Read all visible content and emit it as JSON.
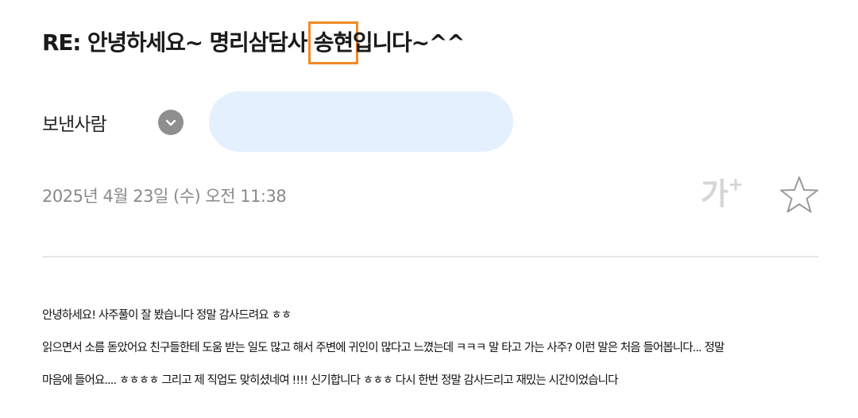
{
  "mail": {
    "subject_before": "RE: 안녕하세요~ 명리삼담사 ",
    "subject_highlight": "송현",
    "subject_after": "입니다~^^",
    "sender_label": "보낸사람",
    "sender_value": "",
    "date": "2025년 4월 23일 (수) 오전 11:38",
    "body_lines": [
      "안녕하세요! 사주풀이 잘 봤습니다 정말 감사드려요 ㅎㅎ",
      "읽으면서 소름 돋았어요 친구들한테 도움 받는 일도 많고 해서 주변에 귀인이 많다고 느꼈는데 ㅋㅋㅋ 말 타고 가는 사주? 이런 말은 처음 들어봅니다... 정말",
      "마음에 들어요.... ㅎㅎㅎㅎ 그리고 제 직업도 맞히셨네여 !!!! 신기합니다 ㅎㅎㅎ 다시 한번 정말 감사드리고 재밌는 시간이었습니다"
    ]
  },
  "toolbar": {
    "font_size_label": "가",
    "font_size_plus": "+"
  },
  "icons": {
    "expand": "chevron-down-icon",
    "star": "star-outline-icon"
  },
  "colors": {
    "highlight_box": "#f08a24",
    "sender_pill": "#e4f0fd",
    "toggle_bg": "#8f8f8f",
    "muted_text": "#8a8a8a"
  }
}
